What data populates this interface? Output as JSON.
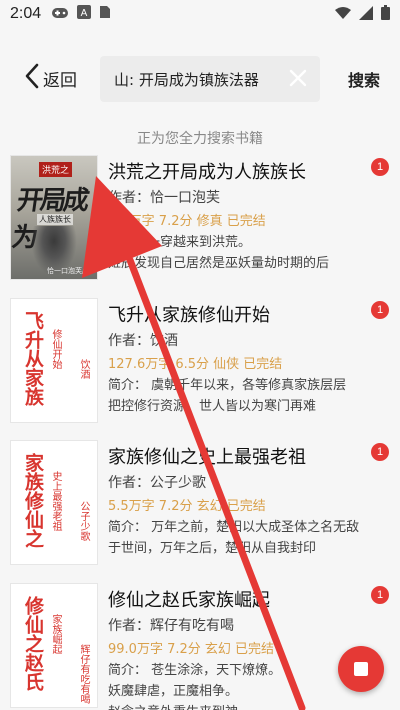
{
  "status_bar": {
    "time": "2:04",
    "left_icons": [
      "gamepad-icon",
      "a-icon",
      "sim-card-icon"
    ],
    "right_icons": [
      "wifi-icon",
      "signal-icon",
      "battery-icon"
    ]
  },
  "header": {
    "back_label": "返回",
    "search_value": "山: 开局成为镇族法器",
    "search_button_label": "搜索"
  },
  "searching_tip": "正为您全力搜索书籍",
  "books": [
    {
      "title": "洪荒之开局成为人族族长",
      "author": "作者：恰一口泡芙",
      "meta": "3.3万字  7.2分  修真  已完结",
      "intro_lines": [
        "简介：一穿越来到洪荒。",
        "姬辰发现自己居然是巫妖量劫时期的后"
      ],
      "badge": "1",
      "cover": {
        "type": "image",
        "top_text": "洪荒之",
        "title": "开局成为",
        "subtitle": "人族族长",
        "author": "恰一口泡芙/著"
      }
    },
    {
      "title": "飞升从家族修仙开始",
      "author": "作者：饮酒",
      "meta": "127.6万字  6.5分  仙侠  已完结",
      "intro_lines": [
        "简介：  虞朝千年以来，各等修真家族层层",
        "把控修行资源，世人皆以为寒门再难"
      ],
      "badge": "1",
      "cover": {
        "type": "generated",
        "v_title": "飞升从家族",
        "v_sub": "修仙开始",
        "v_author": "饮酒"
      }
    },
    {
      "title": "家族修仙之史上最强老祖",
      "author": "作者：公子少歌",
      "meta": "5.5万字  7.2分  玄幻  已完结",
      "intro_lines": [
        "简介：  万年之前，楚阳以大成圣体之名无敌",
        "于世间，万年之后，楚阳从自我封印"
      ],
      "badge": "1",
      "cover": {
        "type": "generated",
        "v_title": "家族修仙之",
        "v_sub": "史上最强老祖",
        "v_author": "公子少歌"
      }
    },
    {
      "title": "修仙之赵氏家族崛起",
      "author": "作者：辉仔有吃有喝",
      "meta": "99.0万字  7.2分  玄幻  已完结",
      "intro_lines": [
        "简介：  苍生涂涂，天下燎燎。",
        "      妖魔肆虐，正魔相争。",
        "      赵念之意外重生来到神"
      ],
      "badge": "1",
      "cover": {
        "type": "generated",
        "v_title": "修仙之赵氏",
        "v_sub": "家族崛起",
        "v_author": "辉仔有吃有喝"
      }
    }
  ],
  "colors": {
    "accent_red": "#e53935",
    "meta_gold": "#d9a04a",
    "cover_red": "#d8352f"
  }
}
